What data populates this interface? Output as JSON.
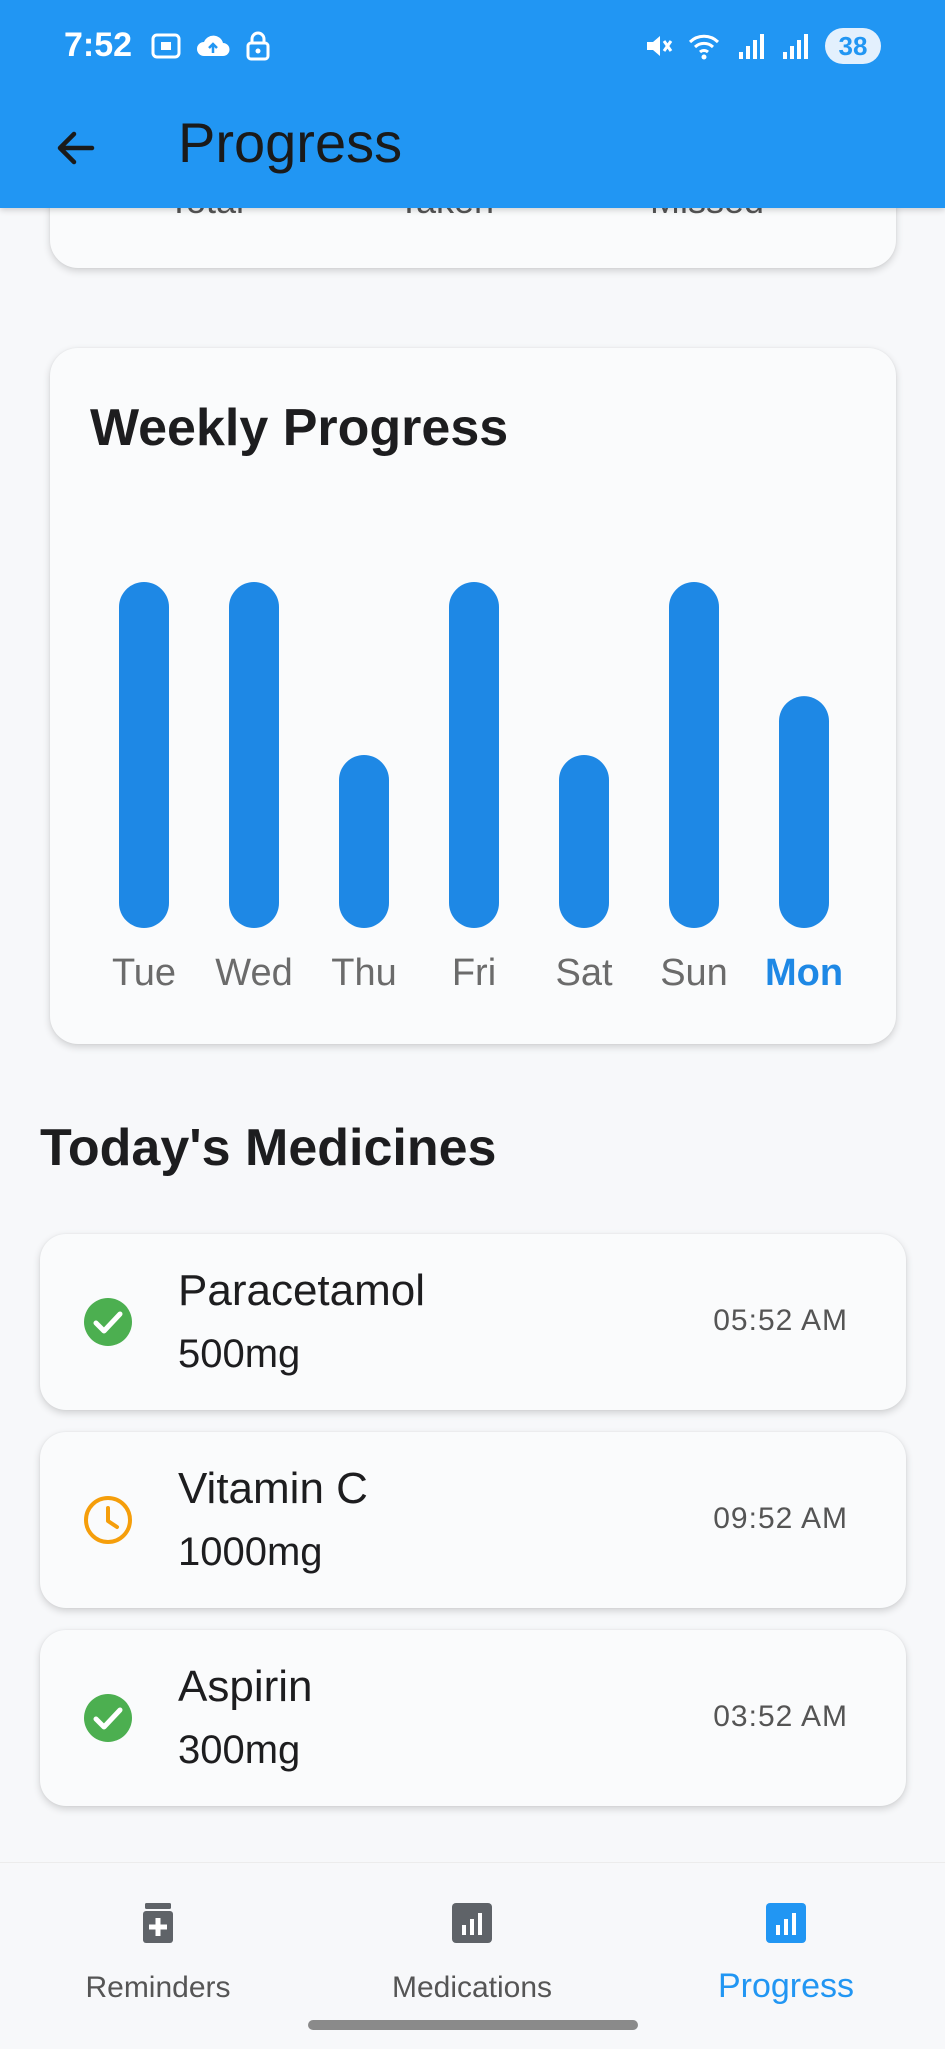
{
  "status_bar": {
    "time": "7:52",
    "battery": "38"
  },
  "app_bar": {
    "title": "Progress"
  },
  "summary": {
    "labels": [
      "Total",
      "Taken",
      "Missed"
    ]
  },
  "weekly": {
    "title": "Weekly Progress",
    "accent": "#1e88e5",
    "active_day": "Mon"
  },
  "chart_data": {
    "type": "bar",
    "categories": [
      "Tue",
      "Wed",
      "Thu",
      "Fri",
      "Sat",
      "Sun",
      "Mon"
    ],
    "values": [
      1.0,
      1.0,
      0.5,
      1.0,
      0.5,
      1.0,
      0.67
    ],
    "ylim": [
      0,
      1
    ],
    "grid": false
  },
  "today": {
    "title": "Today's Medicines",
    "items": [
      {
        "name": "Paracetamol",
        "dose": "500mg",
        "time": "05:52 AM",
        "status": "taken",
        "icon": "check-circle-icon",
        "color": "#4caf50"
      },
      {
        "name": "Vitamin C",
        "dose": "1000mg",
        "time": "09:52 AM",
        "status": "pending",
        "icon": "clock-icon",
        "color": "#f59e0b"
      },
      {
        "name": "Aspirin",
        "dose": "300mg",
        "time": "03:52 AM",
        "status": "taken",
        "icon": "check-circle-icon",
        "color": "#4caf50"
      }
    ]
  },
  "bottom_nav": {
    "items": [
      {
        "label": "Reminders",
        "icon": "medicine-bottle-icon",
        "active": false
      },
      {
        "label": "Medications",
        "icon": "bar-chart-icon",
        "active": false
      },
      {
        "label": "Progress",
        "icon": "bar-chart-icon",
        "active": true
      }
    ],
    "active_color": "#2196f3"
  }
}
